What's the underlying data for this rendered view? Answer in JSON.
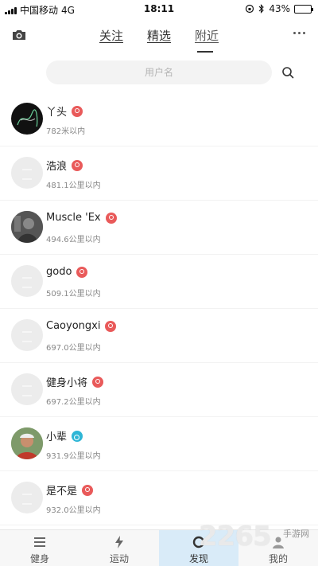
{
  "status_bar": {
    "carrier": "中国移动",
    "network": "4G",
    "time": "18:11",
    "battery": "43%",
    "battery_level": 0.43
  },
  "header": {
    "tabs": [
      {
        "label": "关注"
      },
      {
        "label": "精选"
      },
      {
        "label": "附近"
      }
    ],
    "active_tab": "附近",
    "camera_icon": "camera-icon",
    "more_icon": "more-icon"
  },
  "search": {
    "placeholder": "用户名",
    "icon": "search-icon"
  },
  "users": [
    {
      "name": "丫头",
      "gender": "female",
      "distance": "782米以内",
      "avatar": "photo-dark"
    },
    {
      "name": "浩浪",
      "gender": "female",
      "distance": "481.1公里以内",
      "avatar": "placeholder"
    },
    {
      "name": "Muscle 'Ex",
      "gender": "female",
      "distance": "494.6公里以内",
      "avatar": "photo-gray"
    },
    {
      "name": "godo",
      "gender": "female",
      "distance": "509.1公里以内",
      "avatar": "placeholder"
    },
    {
      "name": "Caoyongxi",
      "gender": "female",
      "distance": "697.0公里以内",
      "avatar": "placeholder"
    },
    {
      "name": "健身小将",
      "gender": "female",
      "distance": "697.2公里以内",
      "avatar": "placeholder"
    },
    {
      "name": "小辈",
      "gender": "male",
      "distance": "931.9公里以内",
      "avatar": "photo-person"
    },
    {
      "name": "是不是",
      "gender": "female",
      "distance": "932.0公里以内",
      "avatar": "placeholder"
    }
  ],
  "bottom_nav": [
    {
      "label": "健身",
      "icon": "list-icon"
    },
    {
      "label": "运动",
      "icon": "lightning-icon"
    },
    {
      "label": "发现",
      "icon": "discover-icon",
      "active": true
    },
    {
      "label": "我的",
      "icon": "profile-icon"
    }
  ],
  "watermark": {
    "number": "2265",
    "text": "手游网"
  },
  "colors": {
    "female_badge": "#e95a5a",
    "male_badge": "#2fb6d6",
    "active_nav_bg": "#d9ebf8"
  }
}
